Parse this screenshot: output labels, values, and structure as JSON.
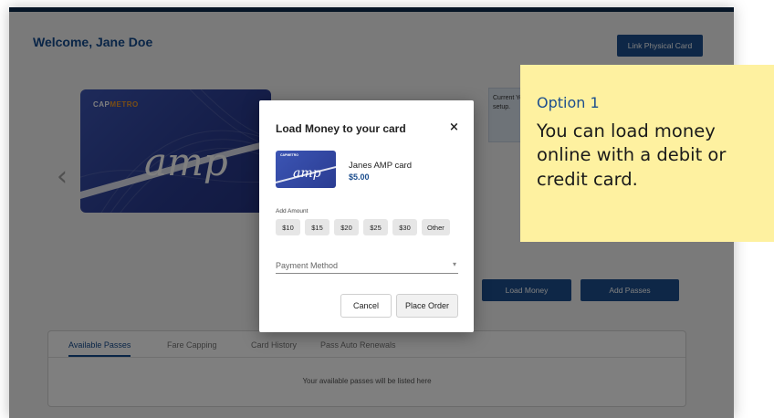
{
  "app": {
    "welcome": "Welcome, Jane Doe",
    "link_card_label": "Link Physical Card",
    "card_brand_left": "CAP",
    "card_brand_right": "METRO",
    "card_logo": "amp",
    "info_peek_text": "Current You cur setup.",
    "load_money_label": "Load Money",
    "add_passes_label": "Add Passes",
    "tabs": [
      {
        "label": "Available Passes",
        "active": true
      },
      {
        "label": "Fare Capping",
        "active": false
      },
      {
        "label": "Card History",
        "active": false
      },
      {
        "label": "Pass Auto Renewals",
        "active": false
      }
    ],
    "empty_message": "Your available passes will be listed here"
  },
  "modal": {
    "title": "Load Money to your card",
    "close_icon": "×",
    "card_name": "Janes AMP card",
    "card_balance": "$5.00",
    "add_amount_label": "Add Amount",
    "amounts": [
      "$10",
      "$15",
      "$20",
      "$25",
      "$30",
      "Other"
    ],
    "payment_method_placeholder": "Payment Method",
    "cancel_label": "Cancel",
    "place_order_label": "Place Order"
  },
  "callout": {
    "title": "Option 1",
    "body": "You can load money online with a debit or credit card."
  },
  "colors": {
    "brand_blue": "#1c4e8e",
    "header_navy": "#0c2a4d",
    "callout_yellow": "#fef1a0",
    "card_blue": "#2a3c92"
  },
  "icons": {
    "close": "close-icon",
    "dropdown": "chevron-down-icon",
    "carousel_prev": "chevron-left-icon"
  }
}
